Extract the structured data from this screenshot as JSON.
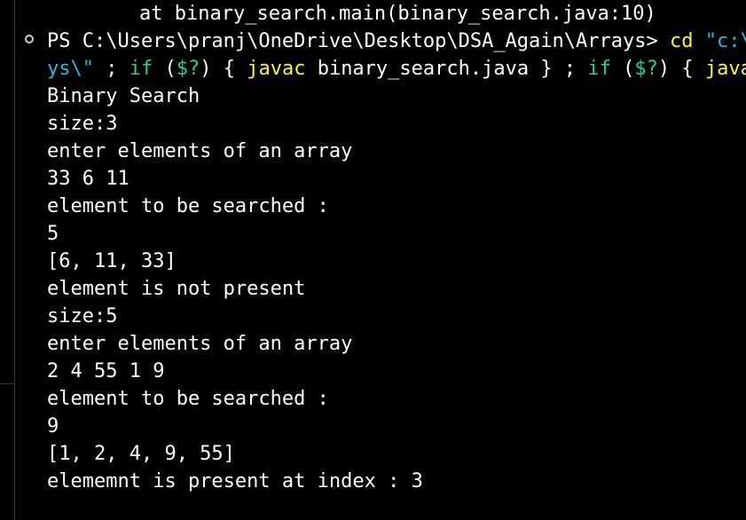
{
  "terminal": {
    "stack_line": "at binary_search.main(binary_search.java:10)",
    "prompt": {
      "ps_path": "PS C:\\Users\\pranj\\OneDrive\\Desktop\\DSA_Again\\Arrays> ",
      "cmd_cd": "cd",
      "cmd_path": " \"c:\\U",
      "cont_str": "ys\\\"",
      "sep1": " ; ",
      "if1": "if",
      "open1": " (",
      "status1": "$?",
      "close1": ") { ",
      "javac": "javac",
      "javac_args": " binary_search.java } ; ",
      "if2": "if",
      "open2": " (",
      "status2": "$?",
      "close2": ") { ",
      "java": "java"
    },
    "output_lines": [
      "Binary Search",
      "size:3",
      "enter elements of an array",
      "33 6 11",
      "element to be searched :",
      "5",
      "[6, 11, 33]",
      "element is not present",
      "size:5",
      "enter elements of an array",
      "2 4 55 1 9",
      "element to be searched :",
      "9",
      "[1, 2, 4, 9, 55]",
      "elememnt is present at index : 3"
    ],
    "colors": {
      "background": "#000000",
      "text": "#ffffff",
      "command": "#f5f543",
      "string": "#29b8db",
      "keyword": "#23d18b"
    }
  }
}
